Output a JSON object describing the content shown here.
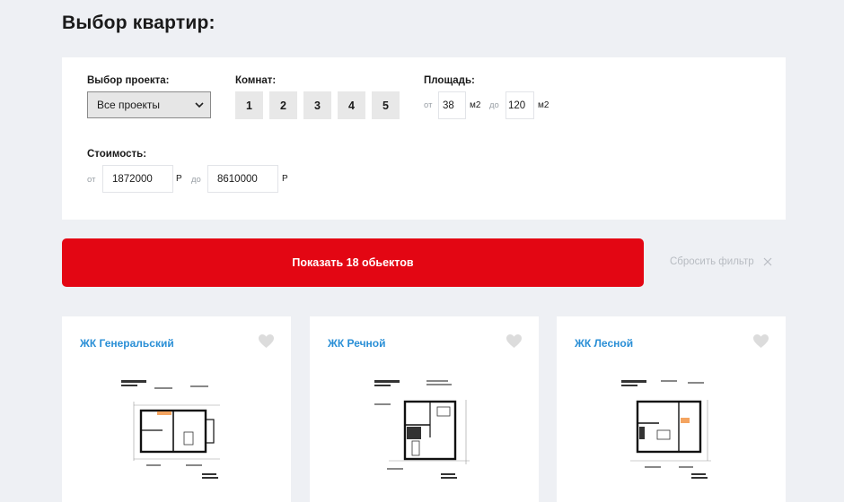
{
  "page": {
    "title": "Выбор квартир:"
  },
  "filters": {
    "project": {
      "label": "Выбор проекта:",
      "selected": "Все проекты"
    },
    "rooms": {
      "label": "Комнат:",
      "options": [
        "1",
        "2",
        "3",
        "4",
        "5"
      ]
    },
    "area": {
      "label": "Площадь:",
      "from_label": "от",
      "from_value": "38",
      "to_label": "до",
      "to_value": "120",
      "unit": "м2"
    },
    "price": {
      "label": "Стоимость:",
      "from_label": "от",
      "from_value": "1872000",
      "to_label": "до",
      "to_value": "8610000",
      "unit": "Р"
    }
  },
  "actions": {
    "show_label": "Показать 18 обьектов",
    "reset_label": "Сбросить фильтр"
  },
  "cards": [
    {
      "title": "ЖК Генеральский"
    },
    {
      "title": "ЖК Речной"
    },
    {
      "title": "ЖК Лесной"
    }
  ],
  "colors": {
    "accent_red": "#e30613",
    "link_blue": "#2a8fd6",
    "bg": "#eef0f4"
  }
}
